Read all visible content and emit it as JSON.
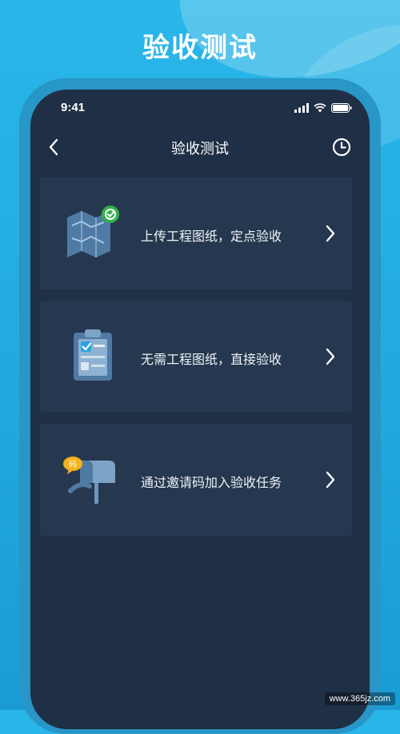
{
  "headline": "验收测试",
  "status_bar": {
    "time": "9:41"
  },
  "nav": {
    "title": "验收测试",
    "back_icon": "chevron-left-icon",
    "history_icon": "clock-icon"
  },
  "cards": [
    {
      "label": "上传工程图纸，定点验收",
      "icon": "blueprint-map-check-icon"
    },
    {
      "label": "无需工程图纸，直接验收",
      "icon": "clipboard-checklist-icon"
    },
    {
      "label": "通过邀请码加入验收任务",
      "icon": "mailbox-invite-icon"
    }
  ],
  "watermark": "www.365jz.com",
  "colors": {
    "accent_blue": "#29b6e8",
    "card_bg": "#26384f",
    "screen_bg": "#1f2f45",
    "check_green": "#2db34a",
    "badge_yellow": "#f5b21b"
  }
}
